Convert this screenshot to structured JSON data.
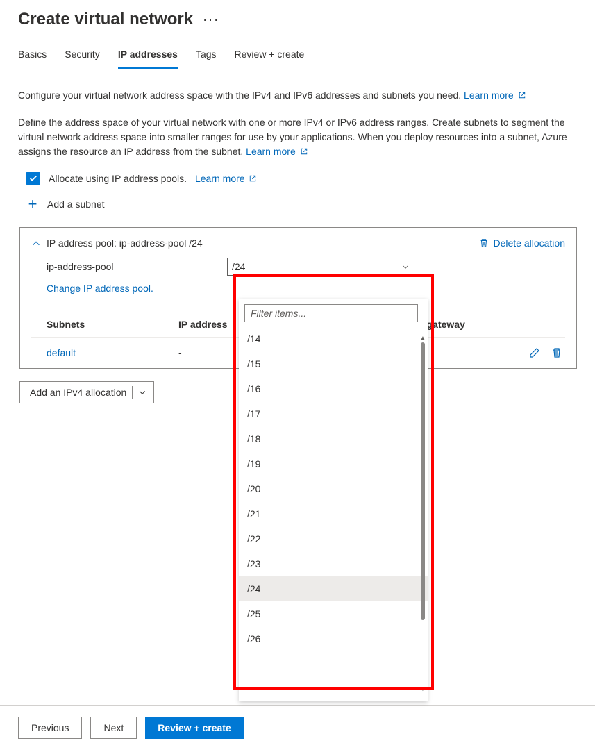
{
  "page_title": "Create virtual network",
  "tabs": {
    "basics": "Basics",
    "security": "Security",
    "ip": "IP addresses",
    "tags": "Tags",
    "review": "Review + create"
  },
  "intro_text": "Configure your virtual network address space with the IPv4 and IPv6 addresses and subnets you need.",
  "learn_more": "Learn more",
  "define_text": "Define the address space of your virtual network with one or more IPv4 or IPv6 address ranges. Create subnets to segment the virtual network address space into smaller ranges for use by your applications. When you deploy resources into a subnet, Azure assigns the resource an IP address from the subnet.",
  "allocate_label": "Allocate using IP address pools.",
  "add_subnet_label": "Add a subnet",
  "pool": {
    "title": "IP address pool: ip-address-pool /24",
    "name": "ip-address-pool",
    "cidr_selected": "/24",
    "change_link": "Change IP address pool.",
    "delete_label": "Delete allocation"
  },
  "subnet_headers": {
    "subnets": "Subnets",
    "ip": "IP address",
    "nat": "NAT gateway"
  },
  "subnet_row": {
    "name": "default",
    "ip": "-",
    "nat": ""
  },
  "add_alloc_label": "Add an IPv4 allocation",
  "dropdown": {
    "filter_placeholder": "Filter items...",
    "options": [
      "/14",
      "/15",
      "/16",
      "/17",
      "/18",
      "/19",
      "/20",
      "/21",
      "/22",
      "/23",
      "/24",
      "/25",
      "/26"
    ],
    "selected": "/24"
  },
  "footer": {
    "previous": "Previous",
    "next": "Next",
    "review": "Review + create"
  }
}
